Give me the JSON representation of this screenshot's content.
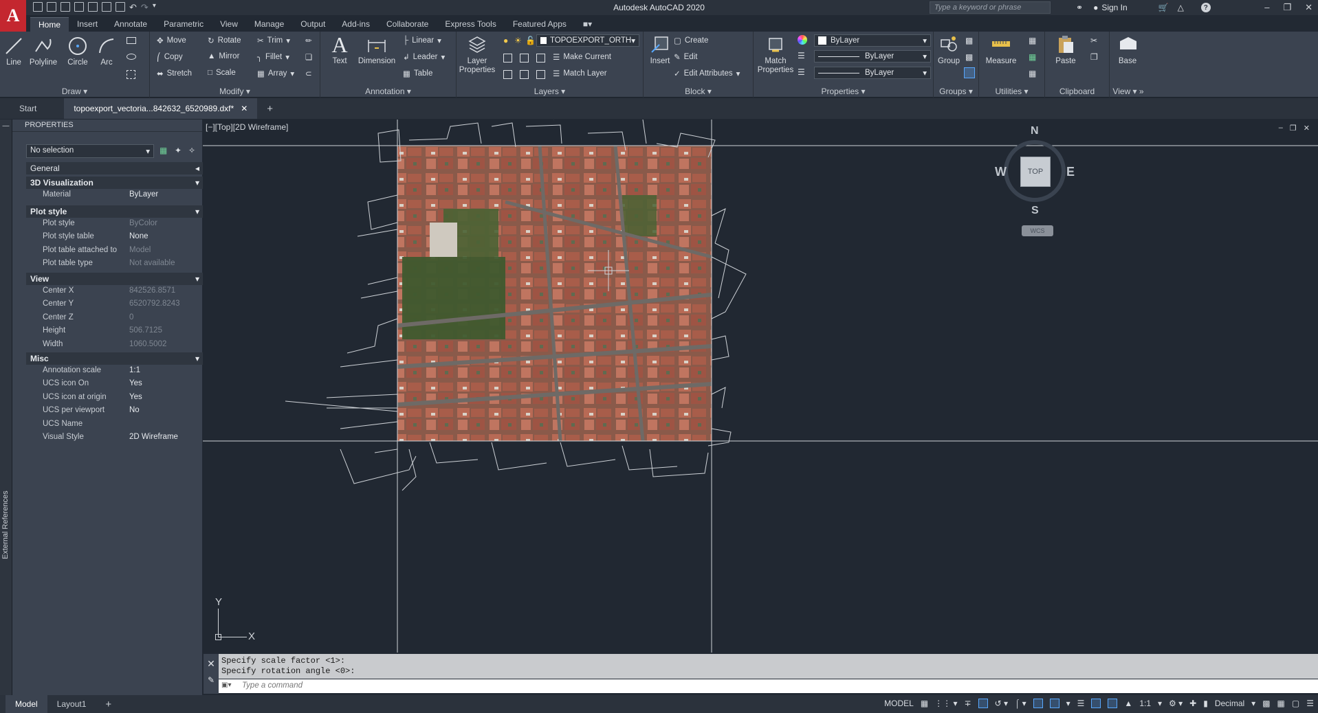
{
  "app": {
    "title": "Autodesk AutoCAD 2020"
  },
  "search": {
    "placeholder": "Type a keyword or phrase"
  },
  "account": {
    "sign_in": "Sign In"
  },
  "ribbon_tabs": [
    "Home",
    "Insert",
    "Annotate",
    "Parametric",
    "View",
    "Manage",
    "Output",
    "Add-ins",
    "Collaborate",
    "Express Tools",
    "Featured Apps"
  ],
  "draw": {
    "title": "Draw",
    "line": "Line",
    "polyline": "Polyline",
    "circle": "Circle",
    "arc": "Arc"
  },
  "modify": {
    "title": "Modify",
    "move": "Move",
    "rotate": "Rotate",
    "trim": "Trim",
    "copy": "Copy",
    "mirror": "Mirror",
    "fillet": "Fillet",
    "stretch": "Stretch",
    "scale": "Scale",
    "array": "Array"
  },
  "annotation": {
    "title": "Annotation",
    "text": "Text",
    "dimension": "Dimension",
    "linear": "Linear",
    "leader": "Leader",
    "table": "Table"
  },
  "layers": {
    "title": "Layers",
    "layer_properties_1": "Layer",
    "layer_properties_2": "Properties",
    "current_layer": "TOPOEXPORT_ORTH",
    "make_current": "Make Current",
    "match_layer": "Match Layer"
  },
  "block": {
    "title": "Block",
    "insert": "Insert",
    "create": "Create",
    "edit": "Edit",
    "edit_attributes": "Edit Attributes"
  },
  "properties_panel": {
    "title": "Properties",
    "match_1": "Match",
    "match_2": "Properties",
    "color": "ByLayer",
    "linetype": "ByLayer",
    "lineweight": "ByLayer"
  },
  "groups": {
    "title": "Groups",
    "group": "Group"
  },
  "utilities": {
    "title": "Utilities",
    "measure": "Measure"
  },
  "clipboard": {
    "title": "Clipboard",
    "paste": "Paste"
  },
  "viewpanel": {
    "title": "View",
    "base": "Base"
  },
  "doc_tabs": {
    "start": "Start",
    "file": "topoexport_vectoria...842632_6520989.dxf*"
  },
  "palette": {
    "title": "PROPERTIES",
    "side_label": "External References",
    "selection": "No selection",
    "general": "General",
    "visualization": {
      "title": "3D Visualization",
      "material_k": "Material",
      "material_v": "ByLayer"
    },
    "plot": {
      "title": "Plot style",
      "rows": [
        {
          "k": "Plot style",
          "v": "ByColor",
          "dim": true
        },
        {
          "k": "Plot style table",
          "v": "None",
          "dim": false
        },
        {
          "k": "Plot table attached to",
          "v": "Model",
          "dim": true
        },
        {
          "k": "Plot table type",
          "v": "Not available",
          "dim": true
        }
      ]
    },
    "view": {
      "title": "View",
      "rows": [
        {
          "k": "Center X",
          "v": "842526.8571",
          "dim": true
        },
        {
          "k": "Center Y",
          "v": "6520792.8243",
          "dim": true
        },
        {
          "k": "Center Z",
          "v": "0",
          "dim": true
        },
        {
          "k": "Height",
          "v": "506.7125",
          "dim": true
        },
        {
          "k": "Width",
          "v": "1060.5002",
          "dim": true
        }
      ]
    },
    "misc": {
      "title": "Misc",
      "rows": [
        {
          "k": "Annotation scale",
          "v": "1:1",
          "dim": false
        },
        {
          "k": "UCS icon On",
          "v": "Yes",
          "dim": false
        },
        {
          "k": "UCS icon at origin",
          "v": "Yes",
          "dim": false
        },
        {
          "k": "UCS per viewport",
          "v": "No",
          "dim": false
        },
        {
          "k": "UCS Name",
          "v": "",
          "dim": false
        },
        {
          "k": "Visual Style",
          "v": "2D Wireframe",
          "dim": false
        }
      ]
    }
  },
  "viewport": {
    "label": "[−][Top][2D Wireframe]"
  },
  "viewcube": {
    "n": "N",
    "s": "S",
    "e": "E",
    "w": "W",
    "top": "TOP",
    "wcs": "WCS"
  },
  "ucs": {
    "x": "X",
    "y": "Y"
  },
  "command": {
    "history": [
      "Specify scale factor <1>:",
      "Specify rotation angle <0>:"
    ],
    "placeholder": "Type a command"
  },
  "status": {
    "model_tab": "Model",
    "layout_tab": "Layout1",
    "model_indicator": "MODEL",
    "scale": "1:1",
    "units": "Decimal"
  },
  "colors": {
    "accent": "#58a8ff",
    "brand": "#c4272f",
    "roof": "#b86a55"
  }
}
